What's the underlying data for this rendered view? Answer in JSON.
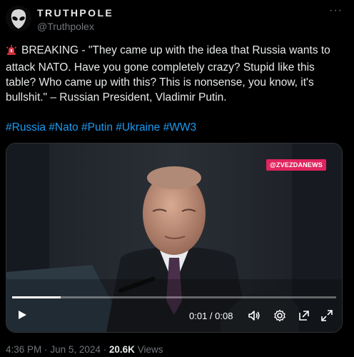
{
  "account": {
    "name": "TRUTHPOLE",
    "handle": "@Truthpolex",
    "more": "···"
  },
  "tweet": {
    "emoji": "siren-icon",
    "text": "BREAKING - \"They came up with the idea that Russia wants to attack NATO. Have you gone completely crazy? Stupid like this table? Who came up with this? This is nonsense, you know, it's bullshit.\" – Russian President, Vladimir Putin.",
    "hashtags": [
      "#Russia",
      "#Nato",
      "#Putin",
      "#Ukraine",
      "#WW3"
    ]
  },
  "video": {
    "badge": "@ZVEZDANEWS",
    "time": "0:01 / 0:08",
    "progress": 0.15,
    "controls": [
      "play-icon",
      "volume-icon",
      "settings-icon",
      "popout-icon",
      "fullscreen-icon"
    ]
  },
  "meta": {
    "time": "4:36 PM",
    "date": "Jun 5, 2024",
    "views_count": "20.6K",
    "views_label": "Views",
    "separator": "·"
  },
  "colors": {
    "background": "#000000",
    "text": "#e7e9ea",
    "muted": "#71767b",
    "link": "#1d9bf0",
    "badge": "#e0245e"
  }
}
